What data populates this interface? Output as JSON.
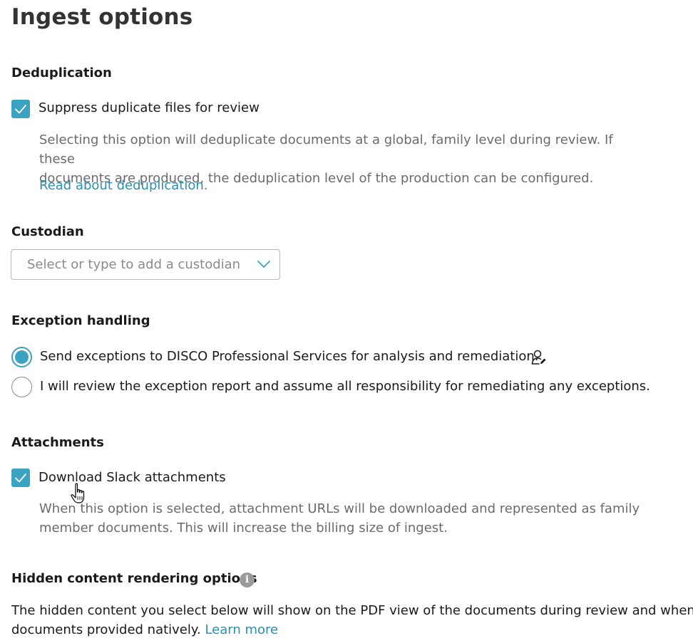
{
  "page_title": "Ingest options",
  "deduplication": {
    "heading": "Deduplication",
    "checkbox_label": "Suppress duplicate files for review",
    "checked": true,
    "help_line1": "Selecting this option will deduplicate documents at a global, family level during review. If these",
    "help_line2": "documents are produced, the deduplication level of the production can be configured.",
    "link_text": "Read about deduplication."
  },
  "custodian": {
    "heading": "Custodian",
    "placeholder": "Select or type to add a custodian"
  },
  "exception_handling": {
    "heading": "Exception handling",
    "options": [
      {
        "label": "Send exceptions to DISCO Professional Services for analysis and remediation.",
        "selected": true
      },
      {
        "label": "I will review the exception report and assume all responsibility for remediating any exceptions.",
        "selected": false
      }
    ],
    "option_icon": "person-edit-icon"
  },
  "attachments": {
    "heading": "Attachments",
    "checkbox_label": "Download Slack attachments",
    "checked": true,
    "help_line1": "When this option is selected, attachment URLs will be downloaded and represented as family",
    "help_line2": "member documents. This will increase the billing size of ingest."
  },
  "hidden_content": {
    "heading": "Hidden content rendering options",
    "info_icon": "info-icon",
    "text_line1": "The hidden content you select below will show on the PDF view of the documents during review and when pro",
    "text_line2": "documents provided natively.",
    "link_text": "Learn more"
  },
  "colors": {
    "accent": "#3aa3c1",
    "link": "#2a8fb0",
    "muted_text": "#6b6b6b"
  }
}
